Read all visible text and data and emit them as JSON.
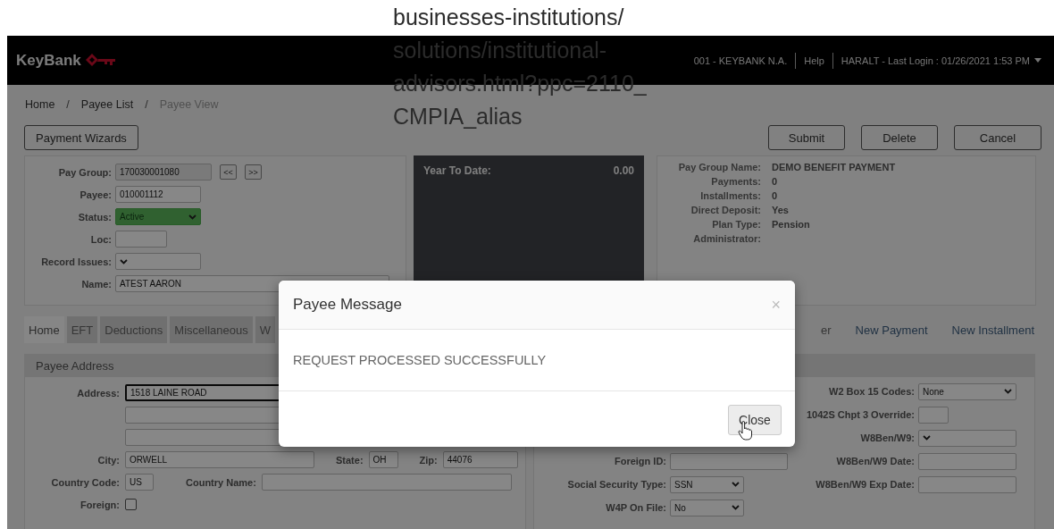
{
  "overlay_text": [
    "businesses-institutions/",
    "solutions/institutional-",
    "advisors.html?ppc=2110_",
    "CMPIA_alias"
  ],
  "header": {
    "logo_text": "KeyBank",
    "org": "001 - KEYBANK N.A.",
    "help": "Help",
    "user": "HARALT - Last Login : 01/26/2021 1:53 PM"
  },
  "breadcrumb": [
    {
      "kind": "link",
      "label": "Home"
    },
    {
      "kind": "sep",
      "label": "/"
    },
    {
      "kind": "link",
      "label": "Payee List"
    },
    {
      "kind": "sep",
      "label": "/"
    },
    {
      "kind": "current",
      "label": "Payee View"
    }
  ],
  "wizard_button": "Payment Wizards",
  "actions": [
    "Submit",
    "Delete",
    "Cancel"
  ],
  "payee_form": [
    {
      "kind": "readonly",
      "label": "Pay Group:",
      "value": "170030001080",
      "nav": [
        "<<",
        ">>"
      ]
    },
    {
      "kind": "input",
      "label": "Payee:",
      "value": "010001112"
    },
    {
      "kind": "status",
      "label": "Status:",
      "value": "Active"
    },
    {
      "kind": "input",
      "label": "Loc:"
    },
    {
      "kind": "select",
      "label": "Record Issues:"
    },
    {
      "kind": "input",
      "label": "Name:",
      "value": "ATEST AARON"
    }
  ],
  "ytd": {
    "label": "Year To Date:",
    "value": "0.00"
  },
  "summary": [
    {
      "label": "Pay Group Name:",
      "value": "DEMO BENEFIT PAYMENT"
    },
    {
      "label": "Payments:",
      "value": "0"
    },
    {
      "label": "Installments:",
      "value": "0"
    },
    {
      "label": "Direct Deposit:",
      "value": "Yes"
    },
    {
      "label": "Plan Type:",
      "value": "Pension"
    },
    {
      "label": "Administrator:"
    }
  ],
  "tabs": [
    {
      "label": "Home",
      "selected": true
    },
    {
      "label": "EFT",
      "selected": false
    },
    {
      "label": "Deductions",
      "selected": false
    },
    {
      "label": "Miscellaneous",
      "selected": false
    },
    {
      "label": "W",
      "selected": false
    }
  ],
  "tab_tail": "er",
  "links": [
    "New Payment",
    "New Installment"
  ],
  "address": {
    "title": "Payee Address",
    "street": {
      "label": "Address:",
      "value": "1518 LAINE ROAD",
      "focused": true
    },
    "city": {
      "label": "City:",
      "value": "ORWELL"
    },
    "state": {
      "label": "State:",
      "value": "OH"
    },
    "zip": {
      "label": "Zip:",
      "value": "44076"
    },
    "country_code": {
      "label": "Country Code:",
      "value": "US"
    },
    "country_name": {
      "label": "Country Name:"
    },
    "foreign": {
      "label": "Foreign:",
      "checked": false
    },
    "right_a": [
      {
        "kind": "input",
        "label": "Foreign ID:"
      },
      {
        "kind": "select",
        "label": "Social Security Type:",
        "value": "SSN"
      },
      {
        "kind": "select",
        "label": "W4P On File:",
        "value": "No"
      }
    ],
    "right_b": [
      {
        "kind": "select",
        "label": "W2 Box 15 Codes:",
        "value": "None"
      },
      {
        "kind": "input",
        "label": "1042S Chpt 3 Override:"
      },
      {
        "kind": "select",
        "label": "W8Ben/W9:"
      },
      {
        "kind": "input",
        "label": "W8Ben/W9 Date:"
      },
      {
        "kind": "input",
        "label": "W8Ben/W9 Exp Date:"
      }
    ]
  },
  "modal": {
    "title": "Payee Message",
    "close_glyph": "×",
    "message": "REQUEST PROCESSED SUCCESSFULLY",
    "button": "Close"
  }
}
